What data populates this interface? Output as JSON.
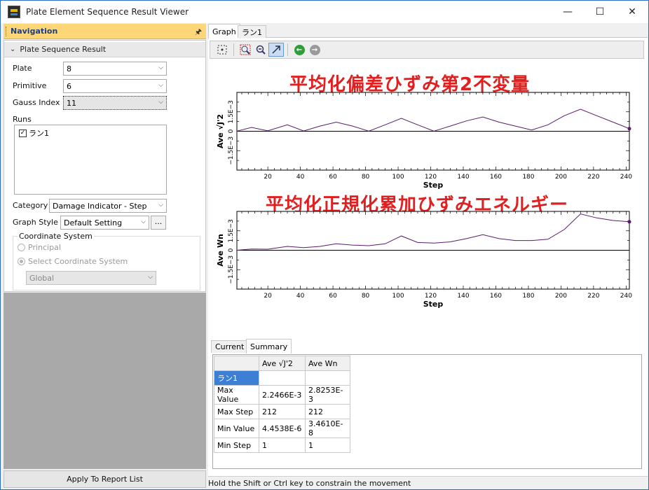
{
  "window": {
    "title": "Plate Element Sequence Result Viewer",
    "minimize": "—",
    "maximize": "☐",
    "close": "✕"
  },
  "nav": {
    "title": "Navigation",
    "pin": "📌",
    "section_title": "Plate Sequence Result",
    "plate_label": "Plate",
    "plate_value": "8",
    "primitive_label": "Primitive",
    "primitive_value": "6",
    "gauss_label": "Gauss Index",
    "gauss_value": "11",
    "runs_label": "Runs",
    "run_item": "ラン1",
    "category_label": "Category",
    "category_value": "Damage Indicator - Step",
    "graph_style_label": "Graph Style",
    "graph_style_value": "Default Setting",
    "dots_label": "...",
    "coord_title": "Coordinate System",
    "principal_label": "Principal",
    "select_coord_label": "Select Coordinate System",
    "coord_value": "Global",
    "apply_label": "Apply To Report List"
  },
  "tabs_top": [
    "Graph",
    "ラン1"
  ],
  "bottom_tabs": [
    "Current",
    "Summary"
  ],
  "status": "Hold the Shift or Ctrl key to constrain the movement",
  "summary": {
    "headers": [
      "",
      "Ave √J'2",
      "Ave Wn"
    ],
    "rows": [
      [
        "ラン1",
        "",
        ""
      ],
      [
        "Max Value",
        "2.2466E-3",
        "2.8253E-3"
      ],
      [
        "Max Step",
        "212",
        "212"
      ],
      [
        "Min Value",
        "4.4538E-6",
        "3.4610E-8"
      ],
      [
        "Min Step",
        "1",
        "1"
      ]
    ]
  },
  "colors": {
    "accent": "#3d7fd4",
    "nav_header": "#fcd677",
    "title_red": "#e02020",
    "line": "#5a1a6e"
  },
  "chart_data": [
    {
      "type": "line",
      "title": "平均化偏差ひずみ第2不変量",
      "xlabel": "Step",
      "ylabel": "Ave √J'2",
      "xlim": [
        1,
        242
      ],
      "ylim": [
        -0.003,
        0.003
      ],
      "xticks": [
        20,
        40,
        60,
        80,
        100,
        120,
        140,
        160,
        180,
        200,
        220,
        240
      ],
      "yticks": [
        "1.5E−3",
        "0",
        "−1.5E−3"
      ],
      "ytick_values": [
        0.0015,
        0,
        -0.0015
      ],
      "series": [
        {
          "x": [
            1,
            10,
            20,
            32,
            42,
            52,
            62,
            72,
            82,
            92,
            102,
            112,
            122,
            132,
            142,
            152,
            162,
            172,
            182,
            192,
            202,
            212,
            222,
            232,
            242
          ],
          "y": [
            1e-05,
            0.0003,
            3e-05,
            0.0005,
            2e-05,
            0.0004,
            0.0007,
            0.0004,
            1e-05,
            0.0005,
            0.001,
            0.0005,
            1e-05,
            0.0004,
            0.0008,
            0.0011,
            0.0007,
            0.0004,
            0.0001,
            0.0005,
            0.0012,
            0.0017,
            0.0012,
            0.0007,
            0.0002
          ]
        }
      ]
    },
    {
      "type": "line",
      "title": "平均化正規化累加ひずみエネルギー",
      "xlabel": "Step",
      "ylabel": "Ave Wn",
      "xlim": [
        1,
        242
      ],
      "ylim": [
        -0.003,
        0.003
      ],
      "xticks": [
        20,
        40,
        60,
        80,
        100,
        120,
        140,
        160,
        180,
        200,
        220,
        240
      ],
      "yticks": [
        "1.5E−3",
        "0",
        "−1.5E−3"
      ],
      "ytick_values": [
        0.0015,
        0,
        -0.0015
      ],
      "series": [
        {
          "x": [
            1,
            10,
            20,
            32,
            42,
            52,
            62,
            72,
            82,
            92,
            102,
            112,
            122,
            132,
            142,
            152,
            162,
            172,
            182,
            192,
            202,
            212,
            222,
            232,
            242
          ],
          "y": [
            1e-07,
            0.0001,
            8e-05,
            0.0003,
            0.0002,
            0.0003,
            0.0005,
            0.0004,
            0.00035,
            0.0005,
            0.0011,
            0.0006,
            0.00055,
            0.00065,
            0.0009,
            0.0012,
            0.0009,
            0.00075,
            0.00075,
            0.00085,
            0.0016,
            0.0028,
            0.0025,
            0.0023,
            0.0022
          ]
        }
      ]
    }
  ]
}
